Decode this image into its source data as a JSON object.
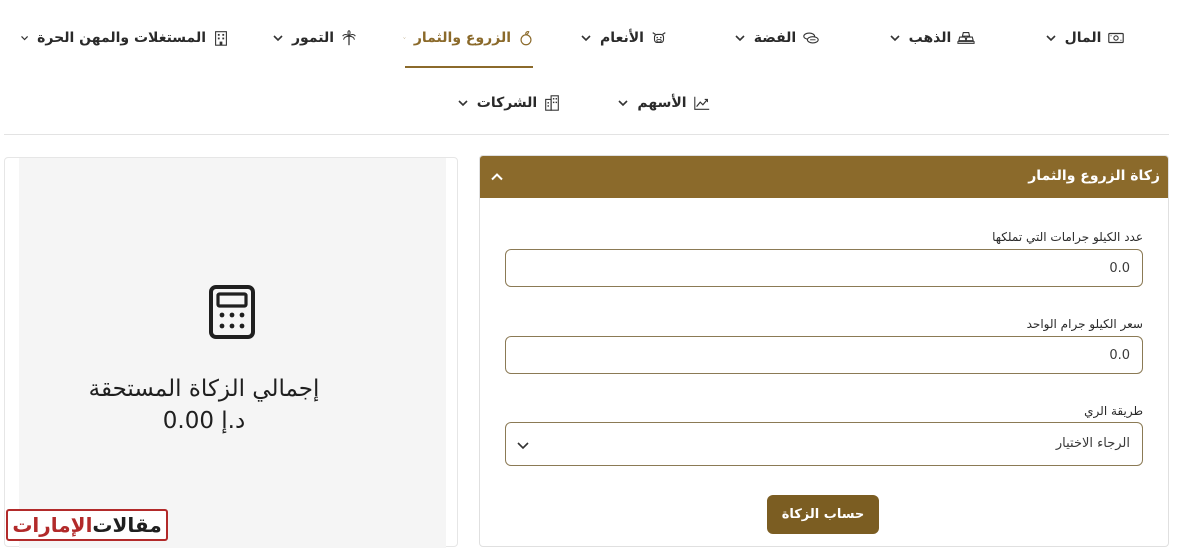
{
  "nav": {
    "items": [
      {
        "label": "المال",
        "icon": "money-icon"
      },
      {
        "label": "الذهب",
        "icon": "gold-bars-icon"
      },
      {
        "label": "الفضة",
        "icon": "silver-coins-icon"
      },
      {
        "label": "الأنعام",
        "icon": "livestock-icon"
      },
      {
        "label": "الزروع والثمار",
        "icon": "crops-icon",
        "active": true
      },
      {
        "label": "التمور",
        "icon": "palm-tree-icon"
      },
      {
        "label": "المستغلات والمهن الحرة",
        "icon": "building-icon"
      },
      {
        "label": "الأسهم",
        "icon": "stocks-chart-icon"
      },
      {
        "label": "الشركات",
        "icon": "companies-icon"
      }
    ]
  },
  "result": {
    "title": "إجمالي الزكاة المستحقة",
    "amount": "0.00 د.إ",
    "icon": "calculator-icon"
  },
  "form": {
    "header_title": "زكاة الزروع والثمار",
    "fields": {
      "kilos": {
        "label": "عدد الكيلو جرامات التي تملكها",
        "value": "0.0"
      },
      "price": {
        "label": "سعر الكيلو جرام الواحد",
        "value": "0.0"
      },
      "irrigation": {
        "label": "طريقة الري",
        "selected": "الرجاء الاختيار"
      }
    },
    "submit_label": "حساب الزكاة"
  },
  "watermark": {
    "part1": "مقالات",
    "part2": "الإمارات"
  },
  "colors": {
    "accent": "#8b6a2b",
    "button": "#7b5d22",
    "panel": "#f5f5f5",
    "watermark_red": "#b22a2a"
  }
}
